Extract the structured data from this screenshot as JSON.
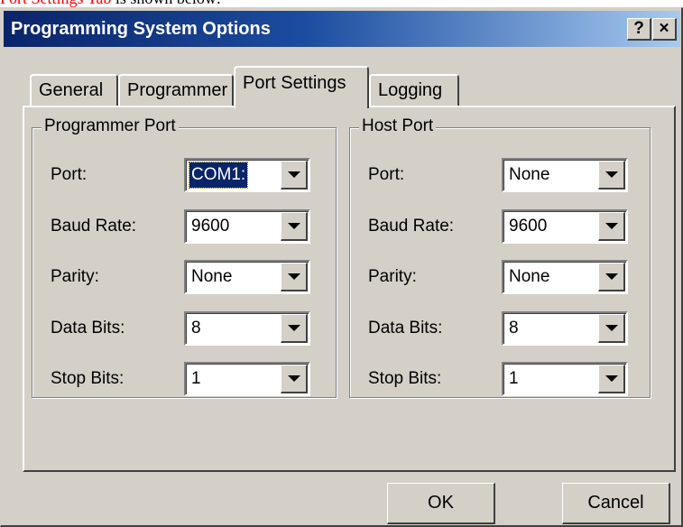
{
  "caption": {
    "highlight": "Port Settings Tab",
    "rest": " is shown below:"
  },
  "window": {
    "title": "Programming System Options",
    "help_label": "?",
    "close_label": "×"
  },
  "tabs": [
    {
      "label": "General",
      "active": false
    },
    {
      "label": "Programmer",
      "active": false
    },
    {
      "label": "Port Settings",
      "active": true
    },
    {
      "label": "Logging",
      "active": false
    }
  ],
  "programmer_port": {
    "title": "Programmer Port",
    "fields": [
      {
        "label": "Port:",
        "value": "COM1:"
      },
      {
        "label": "Baud Rate:",
        "value": "9600"
      },
      {
        "label": "Parity:",
        "value": "None"
      },
      {
        "label": "Data Bits:",
        "value": "8"
      },
      {
        "label": "Stop Bits:",
        "value": "1"
      }
    ]
  },
  "host_port": {
    "title": "Host Port",
    "fields": [
      {
        "label": "Port:",
        "value": "None"
      },
      {
        "label": "Baud Rate:",
        "value": "9600"
      },
      {
        "label": "Parity:",
        "value": "None"
      },
      {
        "label": "Data Bits:",
        "value": "8"
      },
      {
        "label": "Stop Bits:",
        "value": "1"
      }
    ]
  },
  "buttons": {
    "ok": "OK",
    "cancel": "Cancel"
  },
  "colors": {
    "title_start": "#0a246a",
    "title_end": "#a6caf0",
    "face": "#d4d0c8",
    "caption_highlight": "#ff0000"
  }
}
